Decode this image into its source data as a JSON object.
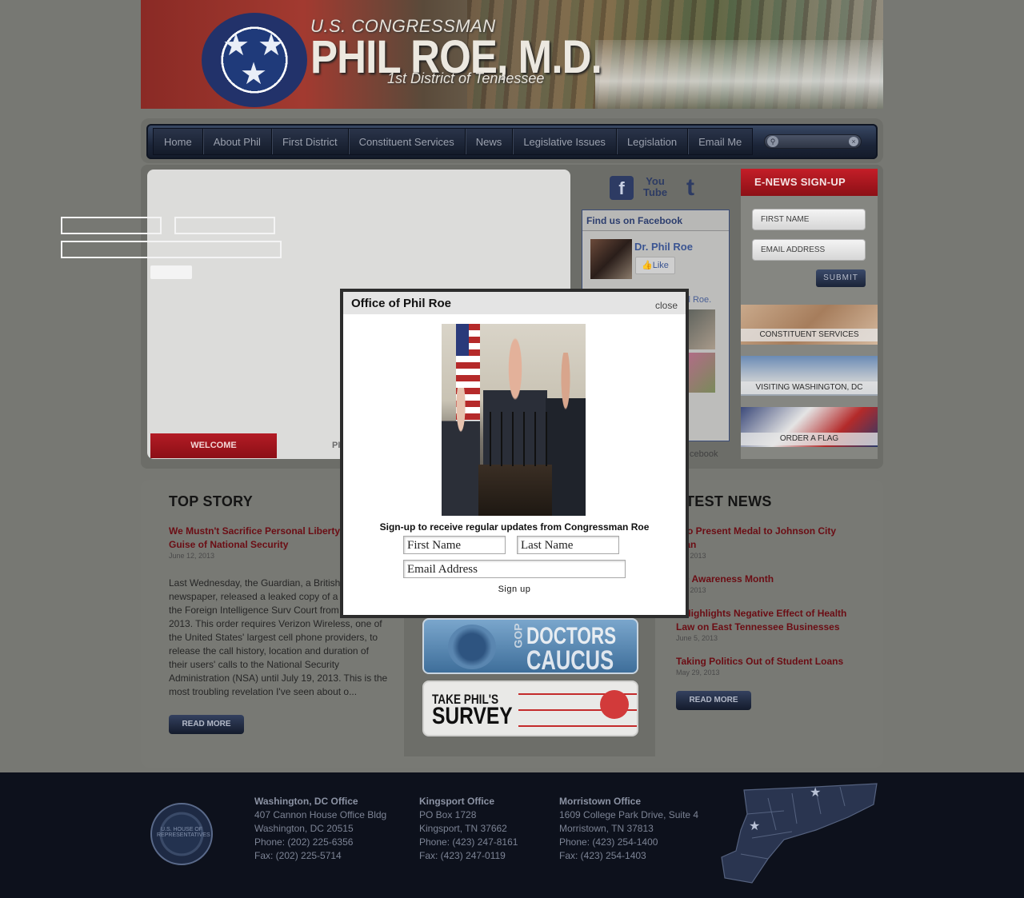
{
  "header": {
    "title_small": "U.S. CONGRESSMAN",
    "title_big": "PHIL ROE, M.D.",
    "subtitle": "1st District of Tennessee"
  },
  "nav": {
    "items": [
      "Home",
      "About Phil",
      "First District",
      "Constituent Services",
      "News",
      "Legislative Issues",
      "Legislation",
      "Email Me"
    ],
    "search_placeholder": ""
  },
  "slideshow": {
    "tabs": [
      "WELCOME",
      "PI"
    ]
  },
  "social": {
    "icons": [
      "facebook-icon",
      "youtube-icon",
      "twitter-icon"
    ],
    "facebook": {
      "header": "Find us on Facebook",
      "page_name": "Dr. Phil Roe",
      "like_label": "Like",
      "partial_text": "il Roe.",
      "footer_partial": "cebook"
    }
  },
  "enews": {
    "title": "E-NEWS SIGN-UP",
    "first_name_placeholder": "FIRST NAME",
    "email_placeholder": "EMAIL ADDRESS",
    "submit_label": "SUBMIT"
  },
  "promos": [
    {
      "label": "CONSTITUENT SERVICES"
    },
    {
      "label": "VISITING WASHINGTON, DC"
    },
    {
      "label": "ORDER A FLAG"
    }
  ],
  "top_story": {
    "section_title": "TOP STORY",
    "title": "We Mustn't Sacrifice Personal Liberty Guise of National Security",
    "date": "June 12, 2013",
    "body": "Last Wednesday, the Guardian, a British newspaper, released a leaked copy of a order from the Foreign Intelligence Surv Court from April 25, 2013. This order requires Verizon Wireless, one of the United States' largest cell phone providers, to release the call history, location and duration of their users' calls to the National Security Administration (NSA) until July 19, 2013. This is the most troubling revelation I've seen about o...",
    "read_more": "READ MORE"
  },
  "banners": {
    "gop": {
      "prefix": "GOP",
      "line1": "DOCTORS",
      "line2": "CAUCUS"
    },
    "survey": {
      "line1": "TAKE PHIL'S",
      "line2": "SURVEY"
    }
  },
  "latest_news": {
    "section_title": "ATEST NEWS",
    "items": [
      {
        "title": "e to Present Medal to Johnson City eran",
        "date": "e 8, 2013"
      },
      {
        "title": "SD Awareness Month",
        "date": "e 5, 2013"
      },
      {
        "title": "e Highlights Negative Effect of Health Law on East Tennessee Businesses",
        "date": "June 5, 2013"
      },
      {
        "title": "Taking Politics Out of Student Loans",
        "date": "May 29, 2013"
      }
    ],
    "read_more": "READ MORE"
  },
  "modal": {
    "title": "Office of Phil Roe",
    "close_label": "close",
    "signup_text": "Sign-up to receive regular updates from Congressman Roe",
    "first_name_placeholder": "First Name",
    "last_name_placeholder": "Last Name",
    "email_placeholder": "Email Address",
    "signup_button": "Sign up"
  },
  "footer": {
    "seal_text": "U.S. HOUSE OF REPRESENTATIVES",
    "offices": [
      {
        "name": "Washington, DC Office",
        "lines": [
          "407 Cannon House Office Bldg",
          "Washington, DC 20515",
          "Phone: (202) 225-6356",
          "Fax: (202) 225-5714"
        ]
      },
      {
        "name": "Kingsport Office",
        "lines": [
          "PO Box 1728",
          "Kingsport, TN 37662",
          "Phone: (423) 247-8161",
          "Fax: (423) 247-0119"
        ]
      },
      {
        "name": "Morristown Office",
        "lines": [
          "1609 College Park Drive, Suite 4",
          "Morristown, TN 37813",
          "Phone: (423) 254-1400",
          "Fax: (423) 254-1403"
        ]
      }
    ]
  },
  "colors": {
    "accent_red": "#b31c25",
    "nav_dark": "#1c2538",
    "link_red": "#6b0d14",
    "footer_bg": "#0d111c"
  }
}
